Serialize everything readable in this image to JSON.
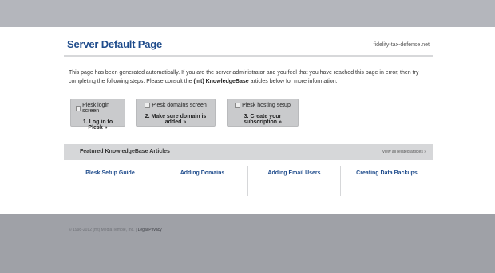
{
  "header": {
    "title": "Server Default Page",
    "domain": "fidelity-tax-defense.net"
  },
  "intro": {
    "part1": "This page has been generated automatically. If you are the server administrator and you feel that you have reached this page in error, then try completing the following steps. Please consult the ",
    "bold": "(mt) KnowledgeBase",
    "part2": " articles below for more information."
  },
  "steps": [
    {
      "image_alt": "Plesk login screen",
      "label": "1. Log in to Plesk »"
    },
    {
      "image_alt": "Plesk domains screen",
      "label": "2. Make sure domain is added »"
    },
    {
      "image_alt": "Plesk hosting setup",
      "label": "3. Create your subscription »"
    }
  ],
  "knowledgebase": {
    "title": "Featured KnowledgeBase Articles",
    "view_all": "View all related articles »",
    "articles": [
      "Plesk Setup Guide",
      "Adding Domains",
      "Adding Email Users",
      "Creating Data Backups"
    ]
  },
  "footer": {
    "copyright": "© 1998-2012 (mt) Media Temple, Inc.",
    "legal": "Legal",
    "privacy": "Privacy"
  }
}
